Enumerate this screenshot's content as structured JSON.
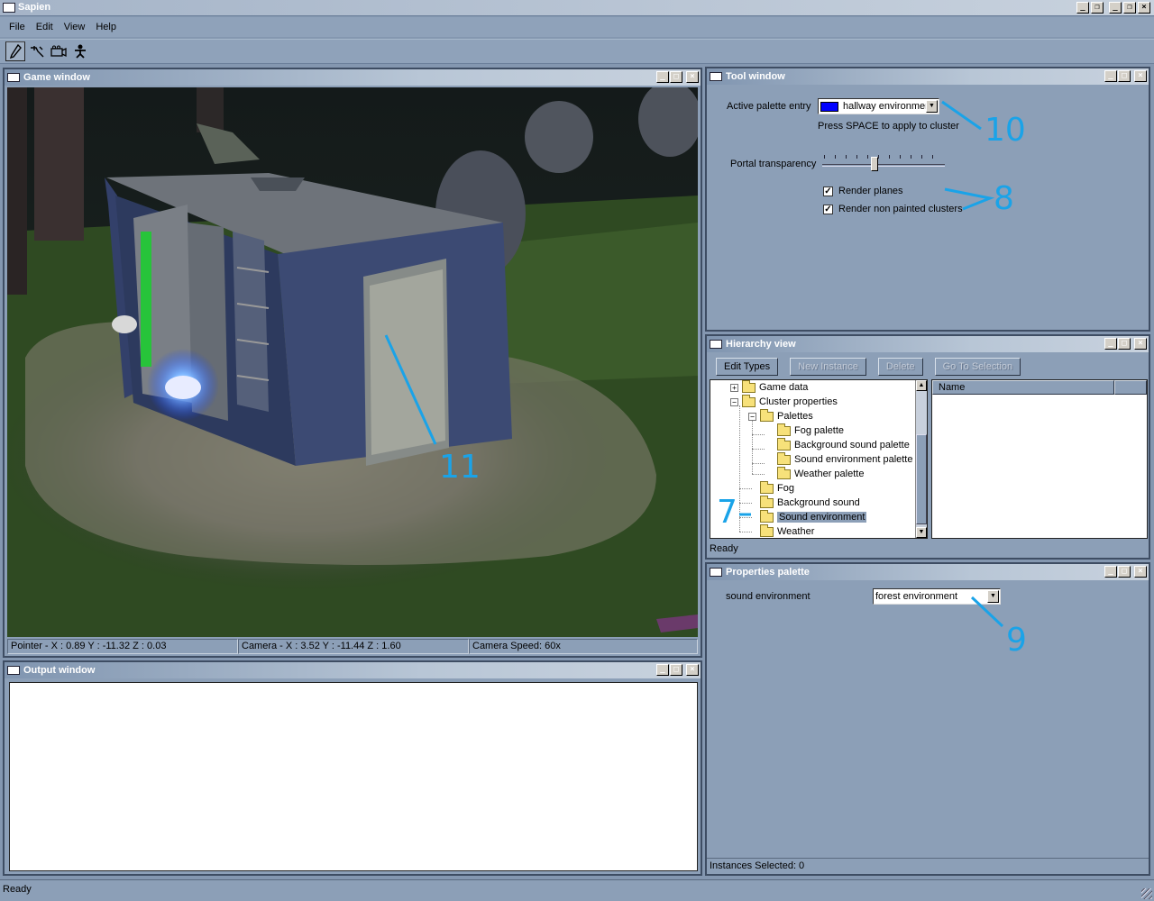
{
  "window": {
    "title": "Sapien"
  },
  "menu": {
    "items": [
      "File",
      "Edit",
      "View",
      "Help"
    ]
  },
  "toolbar": {
    "tools": [
      "pencil-icon",
      "wrench-icon",
      "camera-icon",
      "person-icon"
    ]
  },
  "game_window": {
    "title": "Game window",
    "status": {
      "pointer": "Pointer - X : 0.89  Y : -11.32  Z : 0.03",
      "camera": "Camera - X : 3.52  Y : -11.44  Z : 1.60",
      "speed": "Camera Speed: 60x"
    }
  },
  "output_window": {
    "title": "Output window"
  },
  "tool_window": {
    "title": "Tool window",
    "active_palette_label": "Active palette entry",
    "active_palette_value": "hallway environment",
    "active_palette_color": "#0000ff",
    "hint": "Press SPACE to apply to cluster",
    "portal_label": "Portal transparency",
    "render_planes_label": "Render planes",
    "render_planes_checked": true,
    "render_non_painted_label": "Render non painted clusters",
    "render_non_painted_checked": true
  },
  "hierarchy_view": {
    "title": "Hierarchy view",
    "buttons": {
      "edit_types": "Edit Types",
      "new_instance": "New Instance",
      "delete": "Delete",
      "go_to_selection": "Go To Selection"
    },
    "tree": [
      "Game data",
      "Cluster properties",
      "Palettes",
      "Fog palette",
      "Background sound palette",
      "Sound environment palette",
      "Weather palette",
      "Fog",
      "Background sound",
      "Sound environment",
      "Weather"
    ],
    "list_header": "Name",
    "status": "Ready"
  },
  "properties_palette": {
    "title": "Properties palette",
    "field_label": "sound environment",
    "field_value": "forest environment",
    "status": "Instances Selected: 0"
  },
  "statusbar": {
    "text": "Ready"
  },
  "annotations": {
    "a7": "7",
    "a8": "8",
    "a9": "9",
    "a10": "10",
    "a11": "11",
    "color": "#1aa3e8"
  }
}
